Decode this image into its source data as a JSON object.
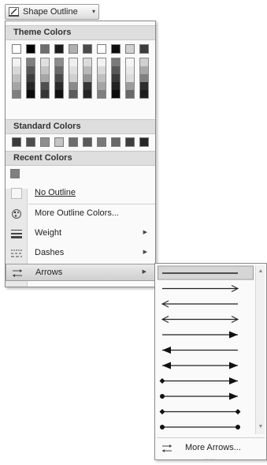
{
  "button": {
    "label": "Shape Outline",
    "icon": "pencil-outline-icon",
    "dropdown_icon": "▾"
  },
  "sections": {
    "theme": "Theme Colors",
    "standard": "Standard Colors",
    "recent": "Recent Colors"
  },
  "theme_colors": [
    [
      "#ffffff",
      "#f2f2f2",
      "#d8d8d8",
      "#bfbfbf",
      "#a5a5a5",
      "#7f7f7f"
    ],
    [
      "#000000",
      "#7f7f7f",
      "#595959",
      "#3f3f3f",
      "#262626",
      "#0c0c0c"
    ],
    [
      "#6d6d6d",
      "#e0e0e0",
      "#c3c3c3",
      "#a6a6a6",
      "#4f4f4f",
      "#353535"
    ],
    [
      "#1a1a1a",
      "#8c8c8c",
      "#6a6a6a",
      "#4a4a4a",
      "#2a2a2a",
      "#111111"
    ],
    [
      "#b0b0b0",
      "#efefef",
      "#dfdfdf",
      "#cfcfcf",
      "#8a8a8a",
      "#5c5c5c"
    ],
    [
      "#4a4a4a",
      "#dbdbdb",
      "#b8b8b8",
      "#959595",
      "#373737",
      "#242424"
    ],
    [
      "#ffffff",
      "#f2f2f2",
      "#d8d8d8",
      "#bfbfbf",
      "#a5a5a5",
      "#7f7f7f"
    ],
    [
      "#0d0d0d",
      "#7a7a7a",
      "#575757",
      "#3a3a3a",
      "#222222",
      "#0a0a0a"
    ],
    [
      "#d0d0d0",
      "#f5f5f5",
      "#e8e8e8",
      "#dcdcdc",
      "#9c9c9c",
      "#686868"
    ],
    [
      "#3c3c3c",
      "#d0d0d0",
      "#a8a8a8",
      "#808080",
      "#2d2d2d",
      "#1e1e1e"
    ]
  ],
  "standard_colors": [
    "#3a3a3a",
    "#4e4e4e",
    "#8e8e8e",
    "#c4c4c4",
    "#6e6e6e",
    "#5a5a5a",
    "#7a7a7a",
    "#686868",
    "#3e3e3e",
    "#262626"
  ],
  "recent_colors": [
    "#808080"
  ],
  "items": {
    "no_outline": "No Outline",
    "more_colors": "More Outline Colors...",
    "weight": "Weight",
    "dashes": "Dashes",
    "arrows": "Arrows"
  },
  "submenu": {
    "more_arrows": "More Arrows...",
    "arrow_styles": [
      {
        "name": "plain-line-arrow-icon",
        "selected": true
      },
      {
        "name": "open-arrow-end-icon"
      },
      {
        "name": "open-arrow-start-icon"
      },
      {
        "name": "open-arrow-both-icon"
      },
      {
        "name": "solid-arrow-end-icon"
      },
      {
        "name": "solid-arrow-start-icon"
      },
      {
        "name": "solid-arrow-both-icon"
      },
      {
        "name": "diamond-start-arrow-end-icon"
      },
      {
        "name": "oval-start-arrow-end-icon"
      },
      {
        "name": "diamond-both-icon"
      },
      {
        "name": "oval-both-icon"
      }
    ]
  }
}
